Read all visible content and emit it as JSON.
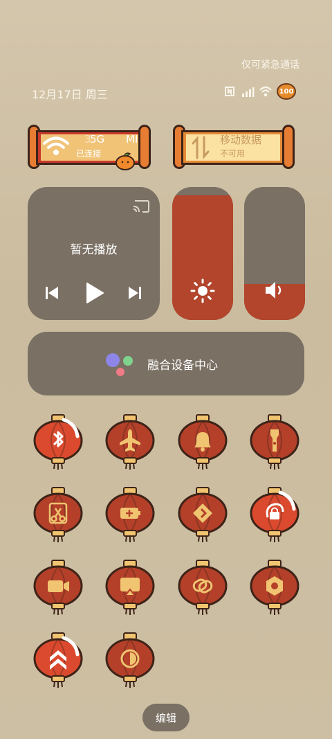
{
  "status_bar": {
    "emergency_text": "仅可紧急通话",
    "date_text": "12月17日 周三",
    "battery_text": "100"
  },
  "wifi_tile": {
    "title": "5G",
    "title_prefix": "3",
    "title_suffix": "MI",
    "status": "已连接"
  },
  "mobile_tile": {
    "title": "移动数据",
    "status": "不可用"
  },
  "media": {
    "label": "暂无播放"
  },
  "sliders": {
    "brightness_level": 0.94,
    "volume_level": 0.27
  },
  "device_center": {
    "label": "融合设备中心"
  },
  "toggles": [
    {
      "name": "bluetooth",
      "icon": "bluetooth-icon",
      "active": true
    },
    {
      "name": "airplane-mode",
      "icon": "airplane-icon",
      "active": false
    },
    {
      "name": "ring-mode",
      "icon": "bell-icon",
      "active": false
    },
    {
      "name": "flashlight",
      "icon": "flashlight-icon",
      "active": false
    },
    {
      "name": "screenshot",
      "icon": "scissors-icon",
      "active": false
    },
    {
      "name": "battery-saver",
      "icon": "battery-plus-icon",
      "active": false
    },
    {
      "name": "directions",
      "icon": "diamond-arrow-icon",
      "active": false
    },
    {
      "name": "rotation-lock",
      "icon": "rotation-lock-icon",
      "active": true
    },
    {
      "name": "screen-record",
      "icon": "video-camera-icon",
      "active": false
    },
    {
      "name": "screen-cast",
      "icon": "cast-screen-icon",
      "active": false
    },
    {
      "name": "link-sharing",
      "icon": "link-icon",
      "active": false
    },
    {
      "name": "settings",
      "icon": "hexagon-nut-icon",
      "active": false
    },
    {
      "name": "performance-mode",
      "icon": "double-chevron-up-icon",
      "active": true
    },
    {
      "name": "dark-mode",
      "icon": "contrast-icon",
      "active": false
    }
  ],
  "edit_button": {
    "label": "编辑"
  },
  "colors": {
    "lantern_red": "#b4402a",
    "lantern_active": "#db4a2e",
    "lantern_outline": "#3d2318",
    "lantern_cap": "#f0c470",
    "card_bg": "#7a7064",
    "slider_fill": "#b2452b"
  }
}
